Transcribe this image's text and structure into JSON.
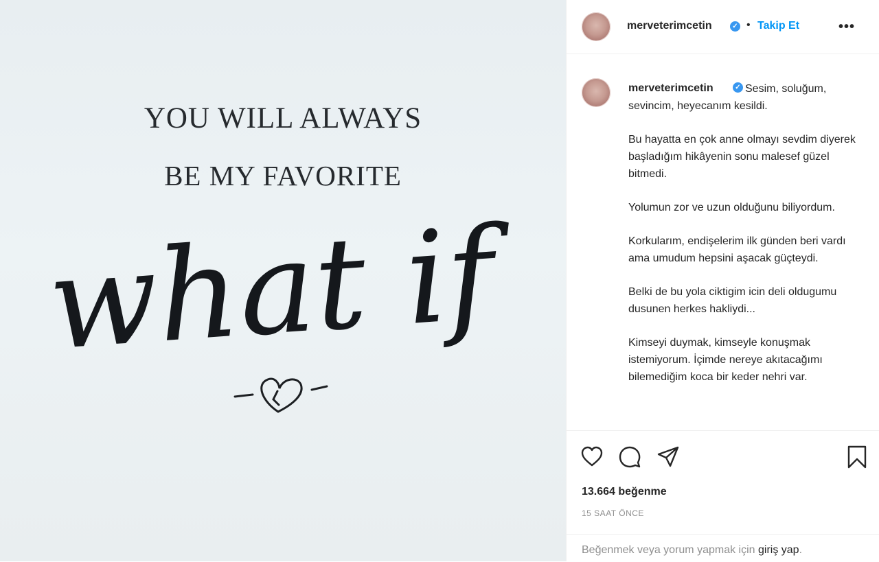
{
  "post_image": {
    "line1": "YOU WILL ALWAYS",
    "line2": "BE MY FAVORITE",
    "script": "what if"
  },
  "header": {
    "username": "merveterimcetin",
    "separator": "•",
    "follow_label": "Takip Et",
    "more_label": "•••"
  },
  "caption": {
    "username": "merveterimcetin",
    "paragraphs": [
      "Sesim, soluğum, sevincim, heyecanım kesildi.",
      "Bu hayatta en çok anne olmayı sevdim diyerek başladığım hikâyenin sonu malesef güzel bitmedi.",
      "Yolumun zor ve uzun olduğunu biliyordum.",
      "Korkularım, endişelerim ilk günden beri vardı ama umudum hepsini aşacak güçteydi.",
      "Belki de bu yola ciktigim icin deli oldugumu dusunen herkes hakliydi...",
      "Kimseyi duymak, kimseyle konuşmak istemiyorum. İçimde nereye akıtacağımı bilemediğim koca bir keder nehri var."
    ]
  },
  "actions": {
    "icons": [
      "heart-icon",
      "comment-icon",
      "share-icon",
      "bookmark-icon"
    ],
    "likes": "13.664 beğenme",
    "timestamp": "15 SAAT ÖNCE"
  },
  "login": {
    "prefix": "Beğenmek veya yorum yapmak için ",
    "link": "giriş yap",
    "suffix": "."
  },
  "colors": {
    "accent": "#0095f6",
    "verified": "#3897f0",
    "text": "#262626",
    "muted": "#8e8e8e"
  }
}
